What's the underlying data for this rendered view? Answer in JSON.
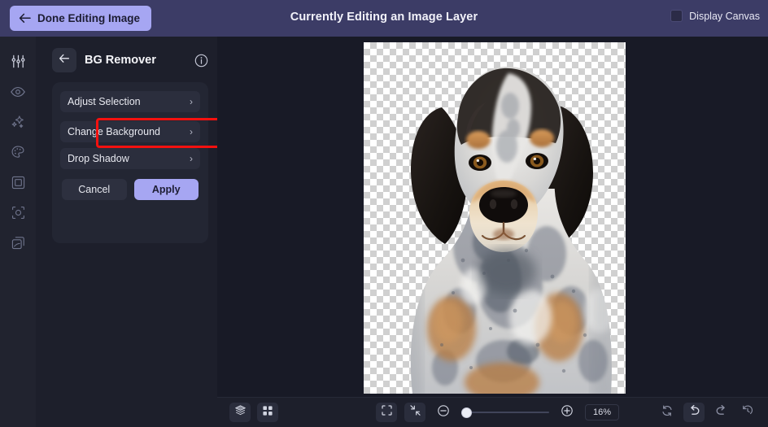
{
  "topbar": {
    "done_button": "Done Editing Image",
    "back_arrow_icon": "arrow-left-icon",
    "title": "Currently Editing an Image Layer",
    "display_canvas_label": "Display Canvas",
    "display_canvas_checked": false,
    "background_color": "#3c3c66",
    "button_color": "#a6a6f2"
  },
  "rail": {
    "items": [
      {
        "name": "adjustments-icon",
        "label": "Adjust"
      },
      {
        "name": "eye-icon",
        "label": "Visibility"
      },
      {
        "name": "sparkles-icon",
        "label": "Effects"
      },
      {
        "name": "palette-icon",
        "label": "Color"
      },
      {
        "name": "frame-icon",
        "label": "Frame"
      },
      {
        "name": "crop-icon",
        "label": "Crop"
      },
      {
        "name": "layers-copy-icon",
        "label": "Duplicate"
      }
    ]
  },
  "panel": {
    "back_icon": "arrow-left-icon",
    "title": "BG Remover",
    "info_icon": "info-circle-icon",
    "menu": [
      {
        "label": "Adjust Selection",
        "chevron": "›",
        "highlighted": true
      },
      {
        "label": "Change Background",
        "chevron": "›",
        "highlighted": false
      },
      {
        "label": "Drop Shadow",
        "chevron": "›",
        "highlighted": false
      }
    ],
    "cancel_label": "Cancel",
    "apply_label": "Apply",
    "highlight_color": "#f4110f",
    "apply_color": "#a6a6f2"
  },
  "canvas": {
    "transparency_checker": true,
    "subject": "dog photo with removed background"
  },
  "bottombar": {
    "left_icons": [
      {
        "name": "layers-icon",
        "active": true
      },
      {
        "name": "grid-icon",
        "active": true
      }
    ],
    "center_icons": [
      {
        "name": "fit-to-screen-icon",
        "active": true
      },
      {
        "name": "collapse-arrows-icon",
        "active": true
      }
    ],
    "zoom_out_icon": "zoom-out-icon",
    "zoom_in_icon": "zoom-in-icon",
    "zoom_value": "16%",
    "zoom_slider_position": 0,
    "right_icons": [
      {
        "name": "reset-icon",
        "active": false
      },
      {
        "name": "undo-icon",
        "active": true
      },
      {
        "name": "redo-icon",
        "active": false
      },
      {
        "name": "history-icon",
        "active": false
      }
    ]
  }
}
